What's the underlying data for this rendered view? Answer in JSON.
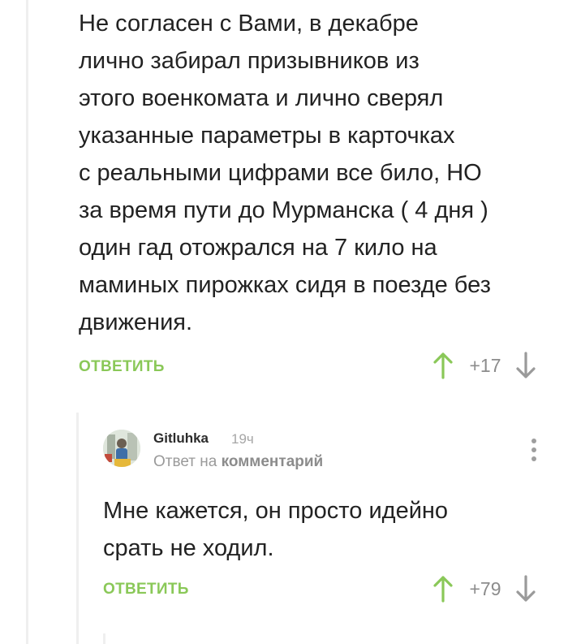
{
  "colors": {
    "accent_green": "#8ac858",
    "muted_gray": "#8c8c8c",
    "thread_line": "#efefef"
  },
  "parent_comment": {
    "text": "Не согласен с Вами, в декабре\nлично забирал призывников из\nэтого военкомата и лично сверял\nуказанные параметры в карточках\nс реальными цифрами все било, НО\nза время пути до Мурманска ( 4 дня )\nодин гад отожрался на 7 кило на\nмаминых пирожках сидя в поезде без\nдвижения.",
    "reply_label": "ОТВЕТИТЬ",
    "score": "+17"
  },
  "reply_comment": {
    "author": "Gitluhka",
    "time": "19ч",
    "reply_to_prefix": "Ответ на",
    "reply_to_link": "комментарий",
    "text": "Мне кажется, он просто идейно\nсрать не ходил.",
    "reply_label": "ОТВЕТИТЬ",
    "score": "+79"
  },
  "icons": {
    "upvote": "arrow-up-icon",
    "downvote": "arrow-down-icon",
    "menu": "more-vertical-icon",
    "avatar": "user-avatar"
  }
}
